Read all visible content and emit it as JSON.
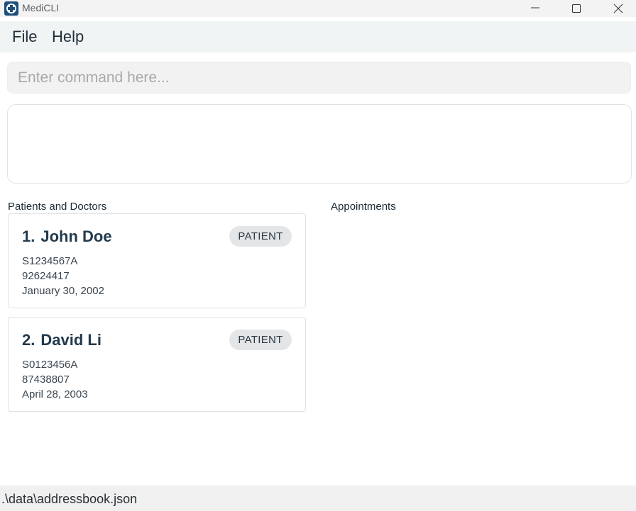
{
  "window": {
    "title": "MediCLI",
    "icon": "medical-cross-icon",
    "controls": [
      "minimize-icon",
      "maximize-icon",
      "close-icon"
    ]
  },
  "menu": {
    "file": "File",
    "help": "Help"
  },
  "command": {
    "placeholder": "Enter command here...",
    "value": ""
  },
  "result": {
    "text": ""
  },
  "lists": {
    "persons_title": "Patients and Doctors",
    "appointments_title": "Appointments"
  },
  "persons": [
    {
      "index": "1.",
      "name": "John Doe",
      "role": "PATIENT",
      "nric": "S1234567A",
      "phone": "92624417",
      "dob": "January 30, 2002"
    },
    {
      "index": "2.",
      "name": "David Li",
      "role": "PATIENT",
      "nric": "S0123456A",
      "phone": "87438807",
      "dob": "April 28, 2003"
    }
  ],
  "status": {
    "path": ".\\data\\addressbook.json"
  },
  "colors": {
    "titlebar": "#f3f3f3",
    "menubar": "#f1f4f5",
    "card_name": "#213a4e",
    "badge_bg": "#e3e5e6",
    "app_icon": "#1d4f7c"
  }
}
